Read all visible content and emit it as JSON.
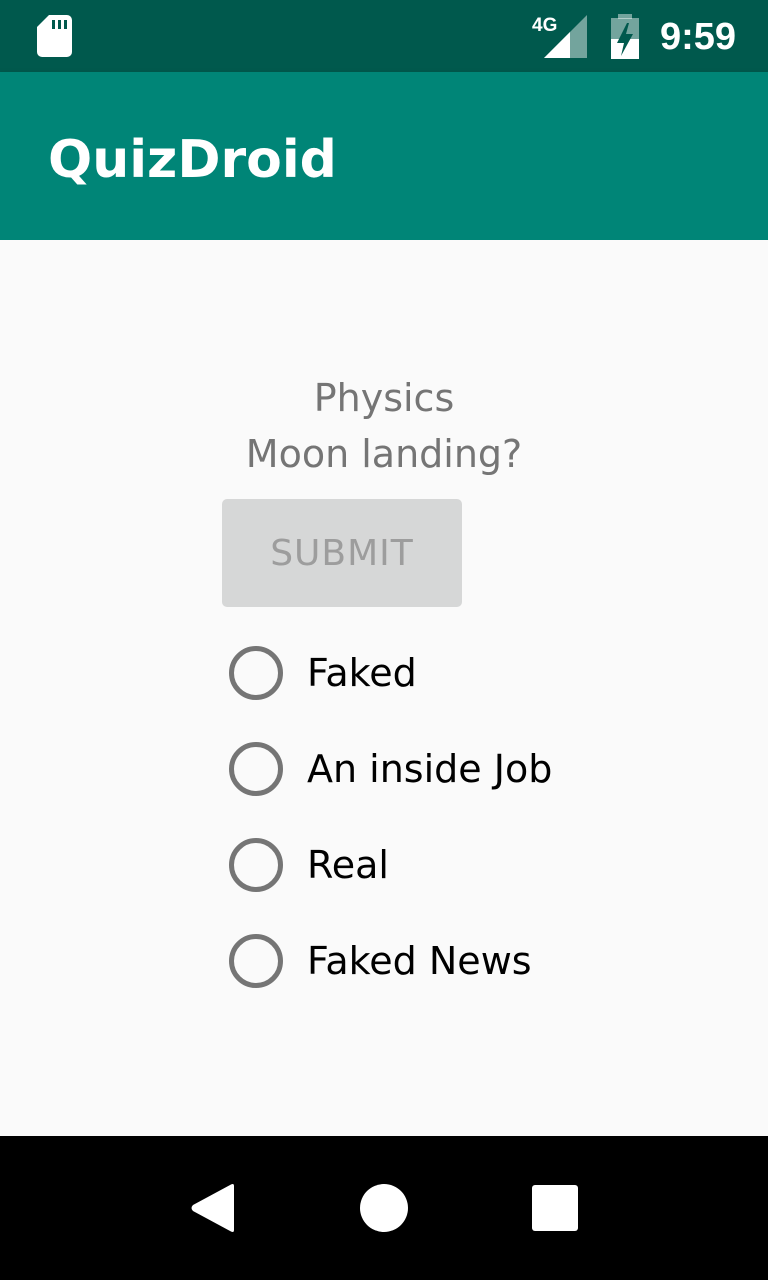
{
  "status_bar": {
    "time": "9:59",
    "network_label": "4G",
    "icons": [
      "sd-card-icon",
      "signal-4g-icon",
      "battery-charging-icon"
    ]
  },
  "app_bar": {
    "title": "QuizDroid",
    "color": "#008577"
  },
  "quiz": {
    "category": "Physics",
    "question": "Moon landing?",
    "submit_label": "SUBMIT",
    "submit_enabled": false,
    "options": [
      {
        "label": "Faked",
        "selected": false
      },
      {
        "label": "An inside Job",
        "selected": false
      },
      {
        "label": "Real",
        "selected": false
      },
      {
        "label": "Faked News",
        "selected": false
      }
    ]
  },
  "nav_bar": {
    "buttons": [
      "back-icon",
      "home-icon",
      "recents-icon"
    ]
  },
  "colors": {
    "status_bar": "#00594d",
    "accent": "#008577",
    "background": "#fafafa",
    "secondary_text": "#757575"
  }
}
